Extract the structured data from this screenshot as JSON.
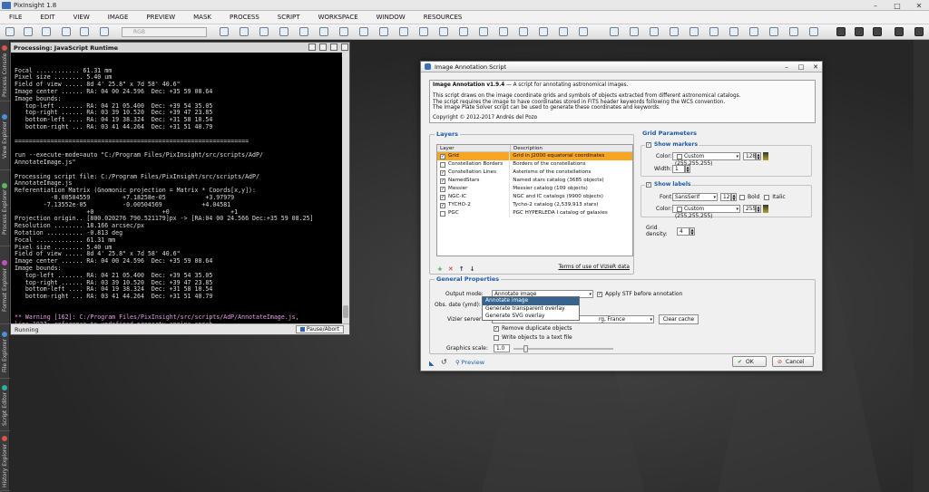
{
  "app": {
    "title": "PixInsight 1.8"
  },
  "menu": [
    "FILE",
    "EDIT",
    "VIEW",
    "IMAGE",
    "PREVIEW",
    "MASK",
    "PROCESS",
    "SCRIPT",
    "WORKSPACE",
    "WINDOW",
    "RESOURCES"
  ],
  "toolbar": {
    "channel_select": "RGB"
  },
  "sidebar": {
    "tabs": [
      "Process Console",
      "View Explorer",
      "Process Explorer",
      "Format Explorer",
      "File Explorer",
      "Script Editor",
      "History Explorer"
    ]
  },
  "console": {
    "title": "Processing: JavaScript Runtime",
    "lines": [
      "Focal ............ 61.31 mm",
      "Pixel size ........ 5.40 um",
      "Field of view ..... 8d 4' 25.8\" x 7d 58' 40.6\"",
      "Image center ...... RA: 04 00 24.596  Dec: +35 59 08.64",
      "Image bounds:",
      "   top-left ....... RA: 04 21 05.400  Dec: +39 54 35.05",
      "   top-right ...... RA: 03 39 10.520  Dec: +39 47 23.85",
      "   bottom-left .... RA: 04 19 38.324  Dec: +31 58 10.54",
      "   bottom-right ... RA: 03 41 44.264  Dec: +31 51 40.79",
      "",
      "=================================================================",
      "",
      "run --execute-mode=auto \"C:/Program Files/PixInsight/src/scripts/AdP/",
      "AnnotateImage.js\"",
      "",
      "Processing script file: C:/Program Files/PixInsight/src/scripts/AdP/",
      "AnnotateImage.js",
      "Referentiation Matrix (Gnomonic projection = Matrix * Coords[x,y]):",
      "          -0.00504559         +7.18258e-05           +3.97979",
      "        -7.13552e-05          -0.00504569           +4.04581",
      "                    +0                   +0                 +1",
      "Projection origin.. [800.020276 790.521179]px -> [RA:04 00 24.566 Dec:+35 59 08.25]",
      "Resolution ........ 18.166 arcsec/px",
      "Rotation .......... -0.813 deg",
      "Focal ............. 61.31 mm",
      "Pixel size ........ 5.40 um",
      "Field of view ..... 8d 4' 25.8\" x 7d 58' 40.6\"",
      "Image center ...... RA: 04 00 24.596  Dec: +35 59 08.64",
      "Image bounds:",
      "   top-left ....... RA: 04 21 05.400  Dec: +39 54 35.05",
      "   top-right ...... RA: 03 39 10.520  Dec: +39 47 23.85",
      "   bottom-left .... RA: 04 19 38.324  Dec: +31 58 10.54",
      "   bottom-right ... RA: 03 41 44.264  Dec: +31 51 40.79"
    ],
    "warning_lines": [
      "** Warning [162]: C:/Program Files/PixInsight/src/scripts/AdP/AnnotateImage.js,",
      "line 1927: reference to undefined property engine.epoch"
    ],
    "status": "Running",
    "pause_label": "Pause/Abort"
  },
  "dialog": {
    "title": "Image Annotation Script",
    "info_title": "Image Annotation v1.9.4",
    "info_title_rest": " — A script for annotating astronomical images.",
    "info_lines": [
      "This script draws on the image coordinate grids and symbols of objects extracted from different astronomical catalogs.",
      "The script requires the image to have coordinates stored in FITS header keywords following the WCS convention.",
      "The Image Plate Solver script can be used to generate these coordinates and keywords."
    ],
    "copyright": "Copyright © 2012-2017 Andrés del Pozo",
    "layers_title": "Layers",
    "layer_headers": {
      "layer": "Layer",
      "description": "Description"
    },
    "layers": [
      {
        "name": "Grid",
        "desc": "Grid in J2000 equatorial coordinates",
        "checked": true,
        "selected": true
      },
      {
        "name": "Constellation Borders",
        "desc": "Borders of the constellations",
        "checked": false,
        "selected": false
      },
      {
        "name": "Constellation Lines",
        "desc": "Asterisms of the constellations",
        "checked": true,
        "selected": false
      },
      {
        "name": "NamedStars",
        "desc": "Named stars catalog (3685 objects)",
        "checked": true,
        "selected": false
      },
      {
        "name": "Messier",
        "desc": "Messier catalog (109 objects)",
        "checked": true,
        "selected": false
      },
      {
        "name": "NGC-IC",
        "desc": "NGC and IC catalogs (9900 objects)",
        "checked": true,
        "selected": false
      },
      {
        "name": "TYCHO-2",
        "desc": "Tycho-2 catalog (2,539,913 stars)",
        "checked": true,
        "selected": false
      },
      {
        "name": "PGC",
        "desc": "PGC HYPERLEDA I catalog of galaxies",
        "checked": false,
        "selected": false
      }
    ],
    "terms_link": "Terms of use of VizieR data",
    "grid_params_title": "Grid Parameters",
    "show_markers": "Show markers",
    "color_label": "Color:",
    "color_value": "Custom (255,255,255)",
    "alpha_value": "128",
    "width_label": "Width:",
    "width_value": "1",
    "show_labels": "Show labels",
    "font_label": "Font:",
    "font_value": "SansSerif",
    "font_size": "12",
    "bold_label": "Bold",
    "italic_label": "Italic",
    "label_color_value": "Custom (255,255,255)",
    "label_alpha": "255",
    "grid_density_label": "Grid density:",
    "grid_density_value": "4",
    "general_title": "General Properties",
    "output_mode_label": "Output mode:",
    "output_mode_value": "Annotate image",
    "apply_stf_label": "Apply STF before annotation",
    "obs_date_label": "Obs. date (ymd):",
    "vizier_label": "Vizier server:",
    "vizier_value": "rg, France",
    "clear_cache": "Clear cache",
    "remove_dup": "Remove duplicate objects",
    "write_text": "Write objects to a text file",
    "graphics_scale_label": "Graphics scale:",
    "graphics_scale_value": "1.0",
    "output_options": [
      "Annotate image",
      "Generate transparent overlay",
      "Generate SVG overlay"
    ],
    "preview_label": "Preview",
    "ok_label": "OK",
    "cancel_label": "Cancel"
  },
  "colors": {
    "accent": "#1e5aa8",
    "selection": "#f6a623",
    "warning": "#e0a0e0"
  }
}
